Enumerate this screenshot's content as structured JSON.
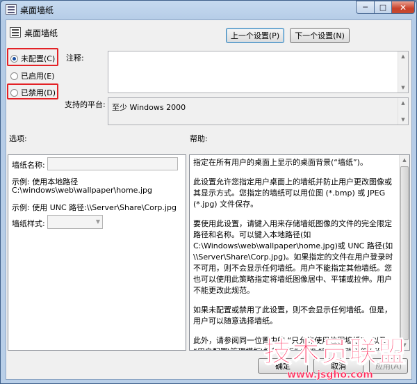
{
  "window": {
    "title": "桌面墙纸",
    "min_symbol": "─",
    "max_symbol": "□",
    "close_symbol": "✕"
  },
  "header": {
    "setting_name": "桌面墙纸",
    "prev_button": "上一个设置(P)",
    "next_button": "下一个设置(N)"
  },
  "state": {
    "options": [
      {
        "label": "未配置(C)",
        "checked": true
      },
      {
        "label": "已启用(E)",
        "checked": false
      },
      {
        "label": "已禁用(D)",
        "checked": false
      }
    ]
  },
  "comment": {
    "label": "注释:"
  },
  "platform": {
    "label": "支持的平台:",
    "value": "至少 Windows 2000"
  },
  "options_panel": {
    "label": "选项:",
    "wallpaper_name_label": "墙纸名称:",
    "example_local_1": "示例: 使用本地路径",
    "example_local_2": "C:\\windows\\web\\wallpaper\\home.jpg",
    "example_unc": "示例: 使用 UNC 路径:\\\\Server\\Share\\Corp.jpg",
    "wallpaper_style_label": "墙纸样式:"
  },
  "help_panel": {
    "label": "帮助:",
    "paragraphs": [
      "指定在所有用户的桌面上显示的桌面背景(“墙纸”)。",
      "此设置允许您指定用户桌面上的墙纸并防止用户更改图像或其显示方式。您指定的墙纸可以用位图 (*.bmp) 或 JPEG (*.jpg) 文件保存。",
      "要使用此设置，请键入用来存储墙纸图像的文件的完全限定路径和名称。可以键入本地路径(如 C:\\Windows\\web\\wallpaper\\home.jpg)或 UNC 路径(如 \\\\Server\\Share\\Corp.jpg)。如果指定的文件在用户登录时不可用，则不会显示任何墙纸。用户不能指定其他墙纸。您也可以使用此策略指定将墙纸图像居中、平铺或拉伸。用户不能更改此规范。",
      "如果未配置或禁用了此设置，则不会显示任何墙纸。但是，用户可以随意选择墙纸。",
      "此外，请参阅同一位置中的 “只允许使用位图墙纸”，以及 “用户配置\\管理模板\\控制面板” 中的 “阻止更改墙纸” 设置。"
    ]
  },
  "footer": {
    "ok_button": "确定",
    "cancel_button": "取消",
    "apply_button": "应用(A)"
  },
  "watermark": {
    "logo_text": "技术员联盟",
    "url_text": "www.jsgho.com"
  }
}
